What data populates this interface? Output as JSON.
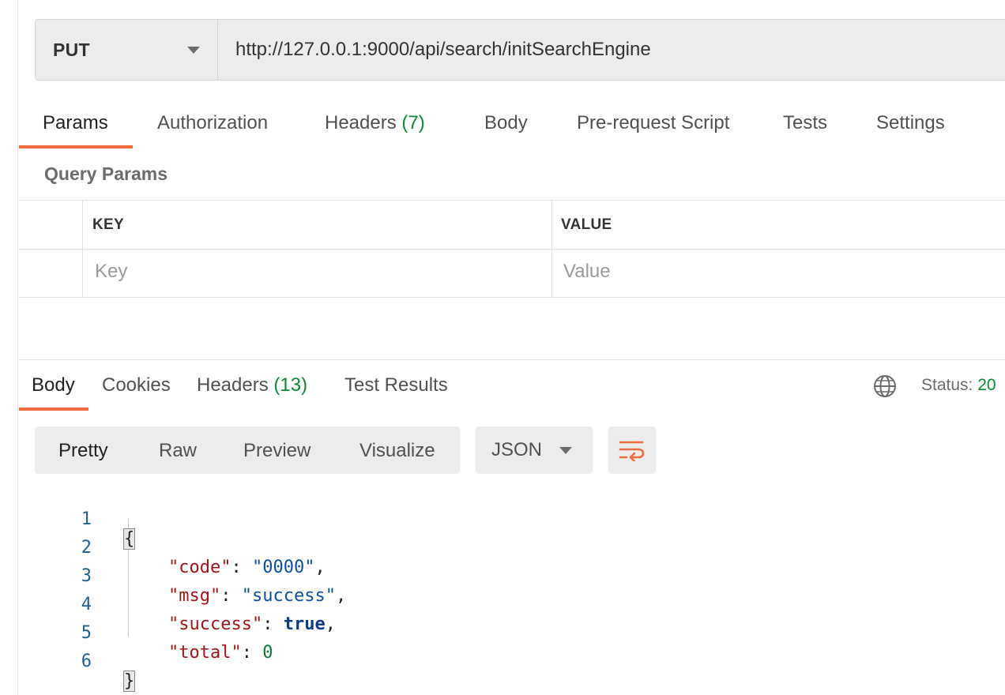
{
  "request": {
    "method": "PUT",
    "url": "http://127.0.0.1:9000/api/search/initSearchEngine",
    "tabs": [
      {
        "label": "Params",
        "count": ""
      },
      {
        "label": "Authorization",
        "count": ""
      },
      {
        "label": "Headers",
        "count": "(7)"
      },
      {
        "label": "Body",
        "count": ""
      },
      {
        "label": "Pre-request Script",
        "count": ""
      },
      {
        "label": "Tests",
        "count": ""
      },
      {
        "label": "Settings",
        "count": ""
      }
    ],
    "active_tab": "Params"
  },
  "query_params": {
    "title": "Query Params",
    "columns": [
      "KEY",
      "VALUE"
    ],
    "key_placeholder": "Key",
    "value_placeholder": "Value"
  },
  "response": {
    "tabs": [
      {
        "label": "Body",
        "count": ""
      },
      {
        "label": "Cookies",
        "count": ""
      },
      {
        "label": "Headers",
        "count": "(13)"
      },
      {
        "label": "Test Results",
        "count": ""
      }
    ],
    "active_tab": "Body",
    "status_label": "Status:",
    "status_value": "20",
    "view_modes": [
      "Pretty",
      "Raw",
      "Preview",
      "Visualize"
    ],
    "active_view": "Pretty",
    "format": "JSON",
    "icons": {
      "globe": "globe-icon",
      "wrap": "wrap-lines-icon",
      "caret": "chevron-down-icon"
    }
  },
  "code": {
    "line_numbers": [
      "1",
      "2",
      "3",
      "4",
      "5",
      "6"
    ],
    "open_brace": "{",
    "close_brace": "}",
    "entries": [
      {
        "key": "\"code\"",
        "value": "\"0000\"",
        "kind": "string",
        "comma": ","
      },
      {
        "key": "\"msg\"",
        "value": "\"success\"",
        "kind": "string",
        "comma": ","
      },
      {
        "key": "\"success\"",
        "value": "true",
        "kind": "bool",
        "comma": ","
      },
      {
        "key": "\"total\"",
        "value": "0",
        "kind": "number",
        "comma": ""
      }
    ]
  },
  "colors": {
    "accent": "#f26b3a",
    "count_green": "#0b8a37",
    "json_key": "#a31515",
    "json_string": "#0b4fa1",
    "json_number": "#0b7a3e"
  }
}
